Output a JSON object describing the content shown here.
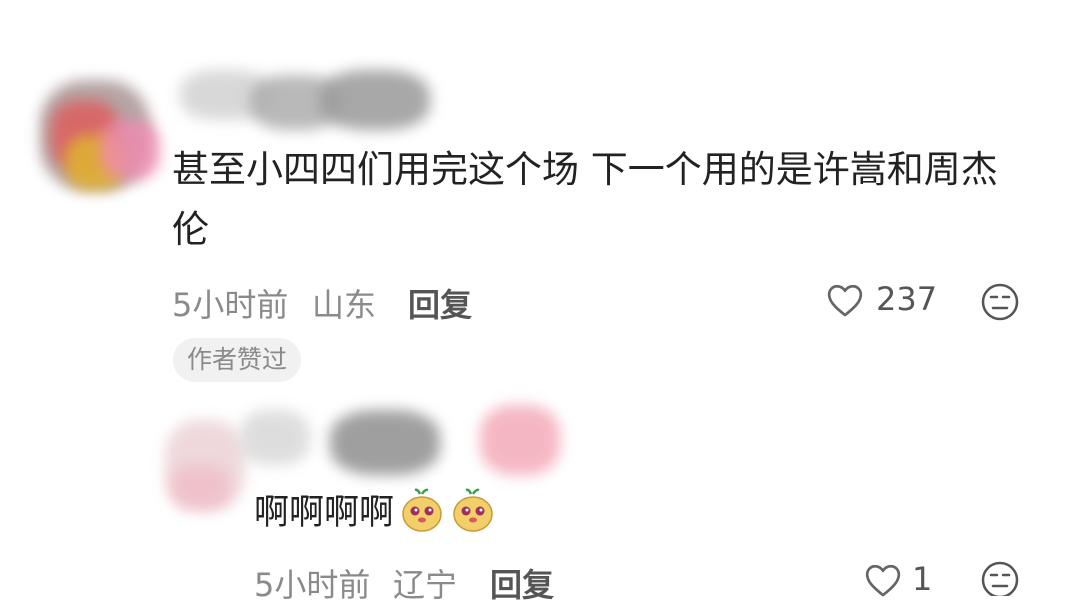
{
  "comments": [
    {
      "text_line1": "甚至小四四们用完这个场 下一个用的是许嵩和周杰",
      "text_line2": "伦",
      "time": "5小时前",
      "location": "山东",
      "reply_label": "回复",
      "like_count": "237",
      "badge": "作者赞过"
    },
    {
      "text": "啊啊啊啊",
      "emoji": [
        "mascot-emoji",
        "mascot-emoji"
      ],
      "time": "5小时前",
      "location": "辽宁",
      "reply_label": "回复",
      "like_count": "1"
    }
  ],
  "colors": {
    "text": "#222222",
    "meta": "#8a8a8a",
    "badge_bg": "#f1f1f1"
  }
}
